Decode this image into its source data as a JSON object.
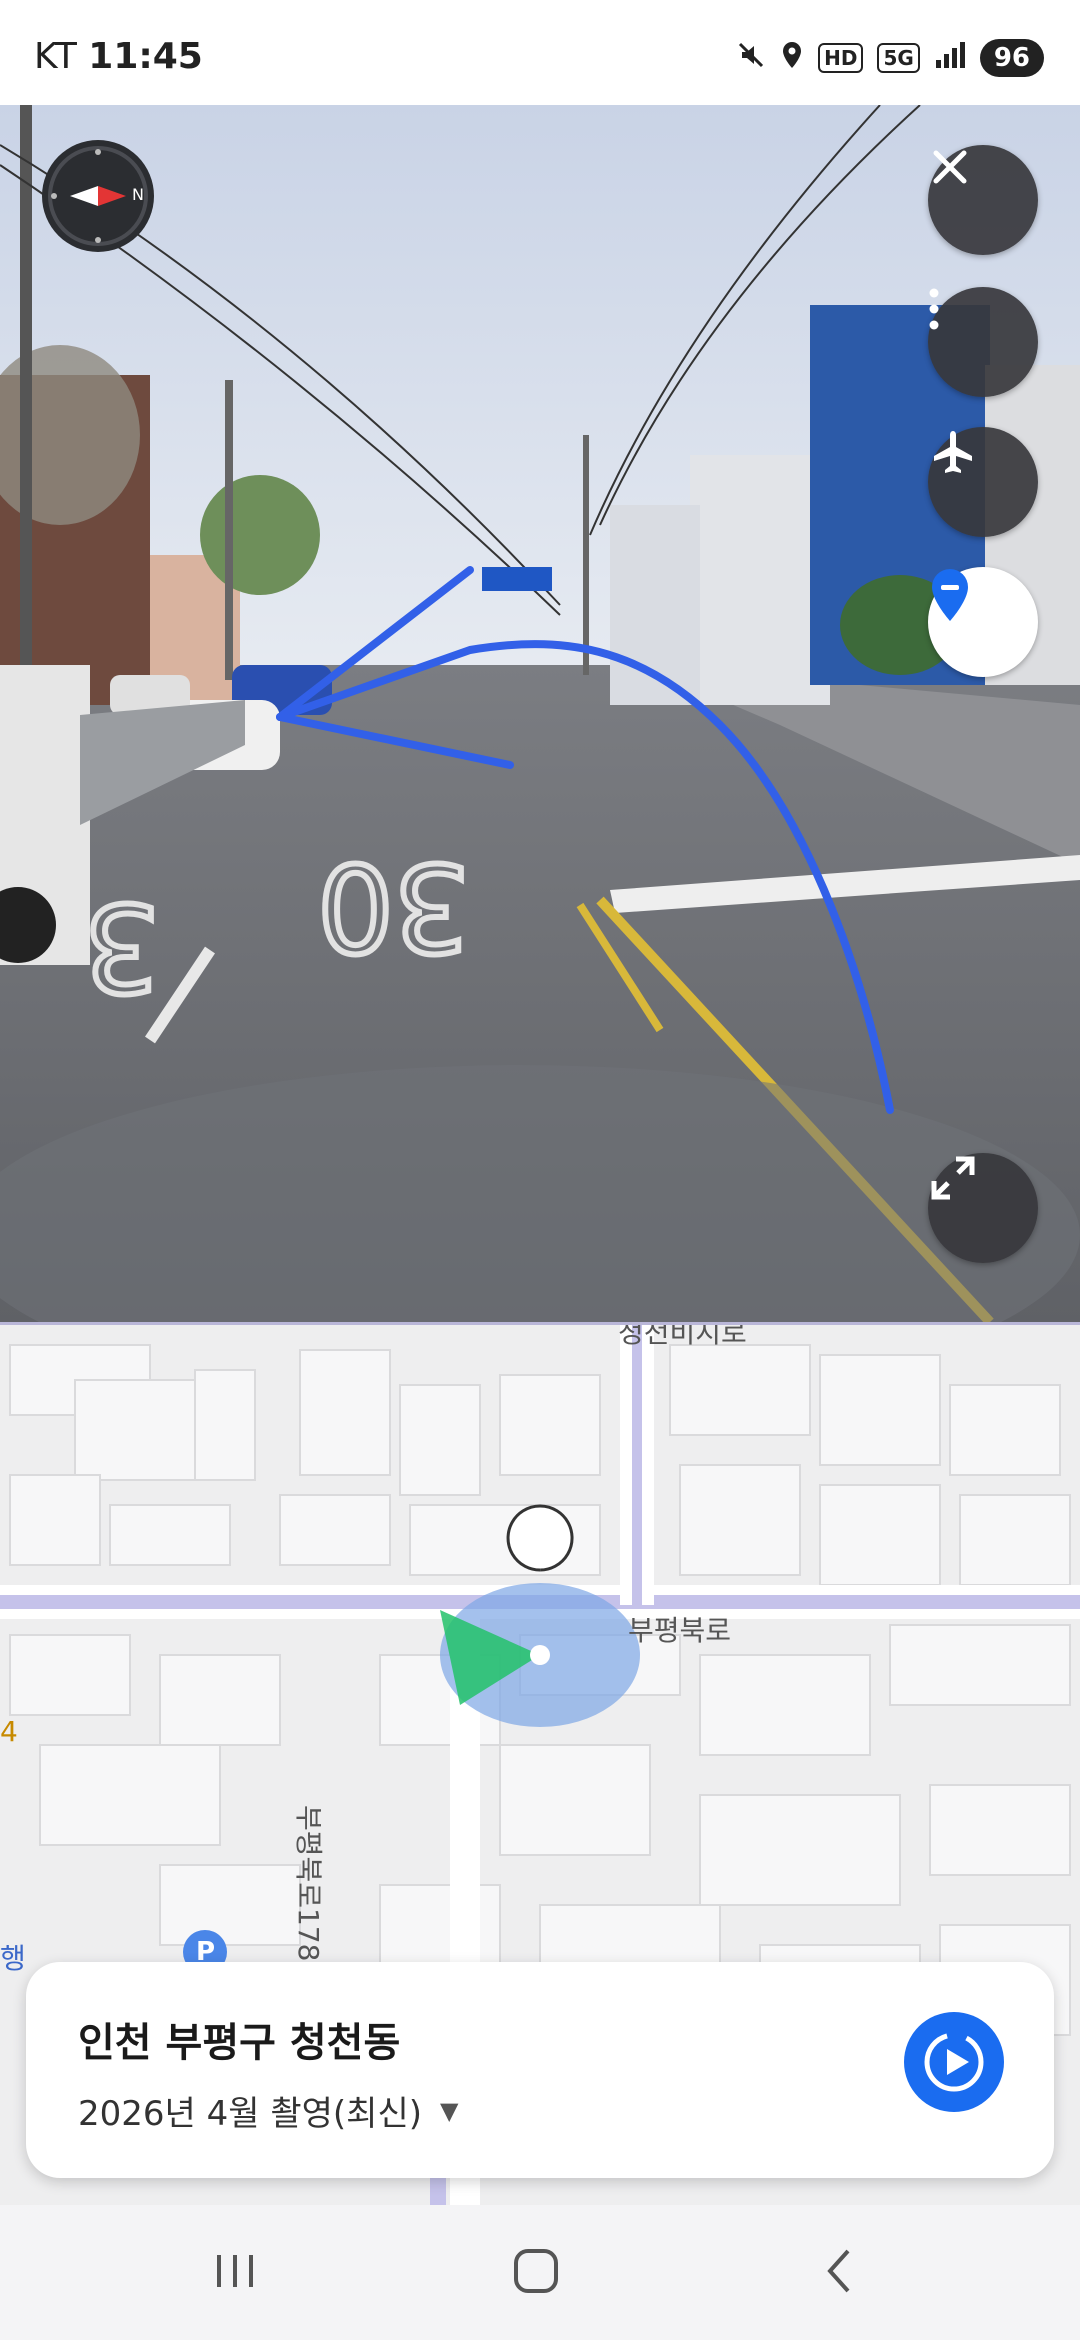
{
  "status_bar": {
    "carrier": "KT",
    "time": "11:45",
    "network_tag_hd": "HD",
    "network_tag_5g": "5G",
    "battery": "96",
    "icons": [
      "mute-icon",
      "location-icon",
      "hd-icon",
      "5g-icon",
      "signal-icon",
      "battery-icon"
    ]
  },
  "street_view": {
    "road_marking_1": "30",
    "road_marking_2": "3",
    "controls": [
      "close-icon",
      "more-icon",
      "airplane-icon",
      "location-pin-icon",
      "expand-icon"
    ]
  },
  "map": {
    "street_top": "청천비지로",
    "street_horizontal": "부평북로",
    "street_vertical": "부평북로178번길",
    "left_edge_number": "4",
    "left_edge_text": "행",
    "parking_marker": "P"
  },
  "info_card": {
    "location": "인천 부평구 청천동",
    "capture_date": "2026년 4월 촬영(최신)",
    "accent_color": "#1a6cf0"
  },
  "nav_bar": {
    "buttons": [
      "recents-icon",
      "home-icon",
      "back-icon"
    ]
  }
}
